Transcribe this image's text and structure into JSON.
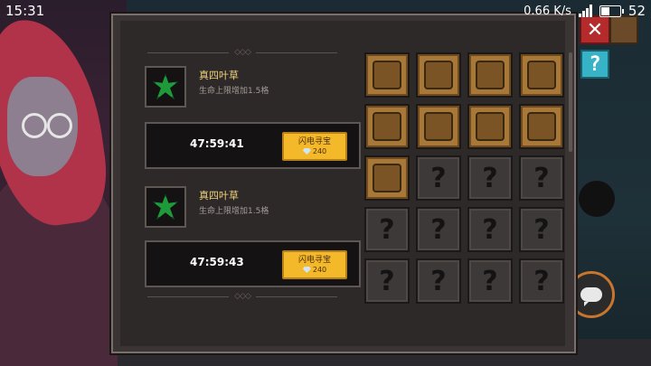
{
  "status_bar": {
    "time": "15:31",
    "speed": "0.66 K/s",
    "battery": "52",
    "battery_level": 0.52
  },
  "hud": {
    "red_icon": "x-icon",
    "help_label": "?"
  },
  "rewards": [
    {
      "name": "真四叶草",
      "description": "生命上限增加1.5格",
      "timer": "47:59:41",
      "button_label": "闪电寻宝",
      "button_cost": "240"
    },
    {
      "name": "真四叶草",
      "description": "生命上限增加1.5格",
      "timer": "47:59:43",
      "button_label": "闪电寻宝",
      "button_cost": "240"
    }
  ],
  "grid": {
    "unknown_label": "?",
    "slots": [
      "item",
      "item",
      "item",
      "item",
      "item",
      "item",
      "item",
      "item",
      "item",
      "unknown",
      "unknown",
      "unknown",
      "unknown",
      "unknown",
      "unknown",
      "unknown",
      "unknown",
      "unknown",
      "unknown",
      "unknown"
    ]
  }
}
